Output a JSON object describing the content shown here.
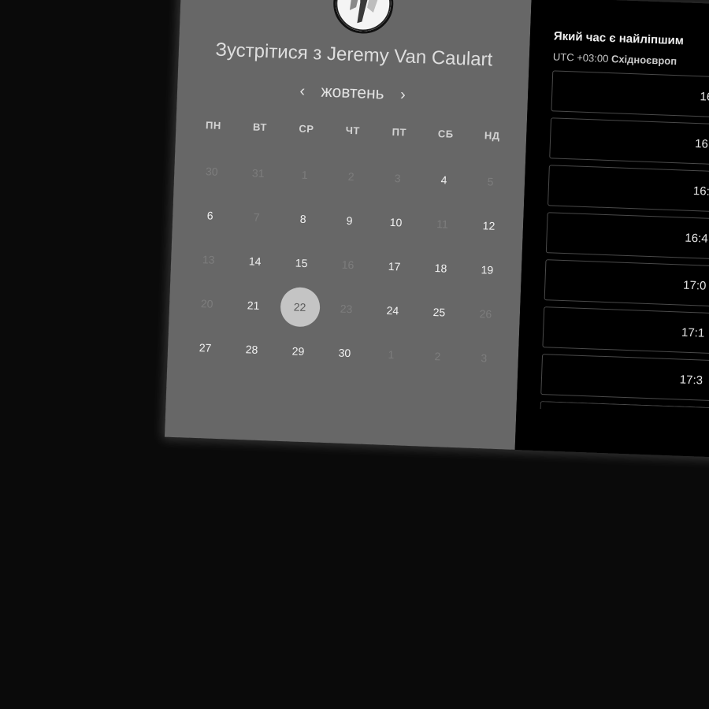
{
  "calendar": {
    "title_prefix": "Зустрітися з",
    "host_name": "Jeremy Van Caulart",
    "month": "жовтень",
    "prev_arrow": "‹",
    "next_arrow": "›",
    "weekdays": [
      "ПН",
      "ВТ",
      "СР",
      "ЧТ",
      "ПТ",
      "СБ",
      "НД"
    ],
    "days": [
      {
        "label": "30",
        "available": false,
        "selected": false
      },
      {
        "label": "31",
        "available": false,
        "selected": false
      },
      {
        "label": "1",
        "available": false,
        "selected": false
      },
      {
        "label": "2",
        "available": false,
        "selected": false
      },
      {
        "label": "3",
        "available": false,
        "selected": false
      },
      {
        "label": "4",
        "available": true,
        "selected": false
      },
      {
        "label": "5",
        "available": false,
        "selected": false
      },
      {
        "label": "6",
        "available": true,
        "selected": false
      },
      {
        "label": "7",
        "available": false,
        "selected": false
      },
      {
        "label": "8",
        "available": true,
        "selected": false
      },
      {
        "label": "9",
        "available": true,
        "selected": false
      },
      {
        "label": "10",
        "available": true,
        "selected": false
      },
      {
        "label": "11",
        "available": false,
        "selected": false
      },
      {
        "label": "12",
        "available": true,
        "selected": false
      },
      {
        "label": "13",
        "available": false,
        "selected": false
      },
      {
        "label": "14",
        "available": true,
        "selected": false
      },
      {
        "label": "15",
        "available": true,
        "selected": false
      },
      {
        "label": "16",
        "available": false,
        "selected": false
      },
      {
        "label": "17",
        "available": true,
        "selected": false
      },
      {
        "label": "18",
        "available": true,
        "selected": false
      },
      {
        "label": "19",
        "available": true,
        "selected": false
      },
      {
        "label": "20",
        "available": false,
        "selected": false
      },
      {
        "label": "21",
        "available": true,
        "selected": false
      },
      {
        "label": "22",
        "available": true,
        "selected": true
      },
      {
        "label": "23",
        "available": false,
        "selected": false
      },
      {
        "label": "24",
        "available": true,
        "selected": false
      },
      {
        "label": "25",
        "available": true,
        "selected": false
      },
      {
        "label": "26",
        "available": false,
        "selected": false
      },
      {
        "label": "27",
        "available": true,
        "selected": false
      },
      {
        "label": "28",
        "available": true,
        "selected": false
      },
      {
        "label": "29",
        "available": true,
        "selected": false
      },
      {
        "label": "30",
        "available": true,
        "selected": false
      },
      {
        "label": "1",
        "available": false,
        "selected": false
      },
      {
        "label": "2",
        "available": false,
        "selected": false
      },
      {
        "label": "3",
        "available": false,
        "selected": false
      }
    ]
  },
  "times": {
    "question": "Який час є найліпшим",
    "timezone_offset": "UTC +03:00",
    "timezone_name": "Східноєвроп",
    "slots": [
      "16",
      "16:",
      "16:",
      "16:4",
      "17:0",
      "17:1",
      "17:3"
    ]
  },
  "colors": {
    "calendar_bg": "#676767",
    "selected_day": "#c4c4c4",
    "times_bg": "#000000",
    "page_bg": "#0a0a0a"
  },
  "icons": {
    "avatar": "host-avatar",
    "prev": "chevron-left-icon",
    "next": "chevron-right-icon"
  }
}
